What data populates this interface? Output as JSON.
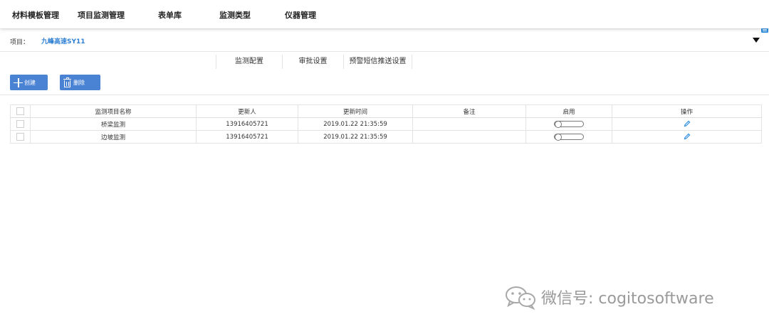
{
  "nav": {
    "items": [
      "材料模板管理",
      "项目监测管理",
      "表单库",
      "监测类型",
      "仪器管理"
    ]
  },
  "project": {
    "label": "项目：",
    "value": "九峰高速SY11"
  },
  "tabs": [
    "监测配置",
    "审批设置",
    "预警短信推送设置"
  ],
  "toolbar": {
    "create_label": "创建",
    "delete_label": "删除"
  },
  "table": {
    "headers": [
      "监测项目名称",
      "更新人",
      "更新时间",
      "备注",
      "启用",
      "操作"
    ],
    "rows": [
      {
        "name": "桥梁监测",
        "updater": "13916405721",
        "time": "2019.01.22 21:35:59",
        "note": "",
        "enabled": false
      },
      {
        "name": "边坡监测",
        "updater": "13916405721",
        "time": "2019.01.22 21:35:59",
        "note": "",
        "enabled": false
      }
    ]
  },
  "watermark": {
    "text": "微信号: cogitosoftware"
  },
  "colors": {
    "accent": "#4a82d4",
    "link": "#2d7fd3",
    "icon_blue": "#2d8ee0"
  },
  "icons": [
    "plus-icon",
    "trash-icon",
    "pencil-icon",
    "caret-down-icon",
    "list-icon",
    "wechat-logo-icon"
  ]
}
